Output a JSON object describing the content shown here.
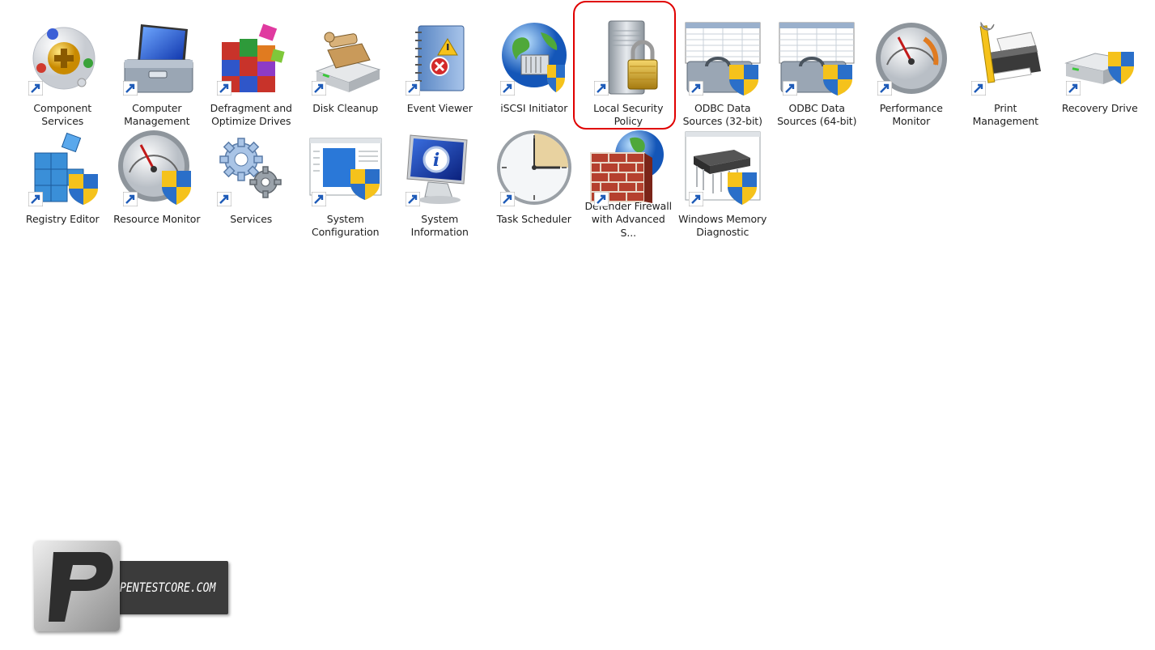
{
  "tools": [
    {
      "id": "component-services",
      "label": "Component Services",
      "icon": "component-services-icon"
    },
    {
      "id": "computer-management",
      "label": "Computer Management",
      "icon": "computer-management-icon"
    },
    {
      "id": "defragment",
      "label": "Defragment and Optimize Drives",
      "icon": "defragment-icon"
    },
    {
      "id": "disk-cleanup",
      "label": "Disk Cleanup",
      "icon": "disk-cleanup-icon"
    },
    {
      "id": "event-viewer",
      "label": "Event Viewer",
      "icon": "event-viewer-icon"
    },
    {
      "id": "iscsi-initiator",
      "label": "iSCSI Initiator",
      "icon": "iscsi-globe-icon"
    },
    {
      "id": "local-security-policy",
      "label": "Local Security Policy",
      "icon": "security-policy-lock-icon",
      "highlighted": true
    },
    {
      "id": "odbc-32",
      "label": "ODBC Data Sources (32-bit)",
      "icon": "odbc-toolbox-icon"
    },
    {
      "id": "odbc-64",
      "label": "ODBC Data Sources (64-bit)",
      "icon": "odbc-toolbox-icon"
    },
    {
      "id": "performance-monitor",
      "label": "Performance Monitor",
      "icon": "gauge-icon"
    },
    {
      "id": "print-management",
      "label": "Print Management",
      "icon": "printer-icon"
    },
    {
      "id": "recovery-drive",
      "label": "Recovery Drive",
      "icon": "recovery-drive-icon"
    },
    {
      "id": "registry-editor",
      "label": "Registry Editor",
      "icon": "registry-cubes-icon"
    },
    {
      "id": "resource-monitor",
      "label": "Resource Monitor",
      "icon": "gauge-shield-icon"
    },
    {
      "id": "services",
      "label": "Services",
      "icon": "gears-icon"
    },
    {
      "id": "system-configuration",
      "label": "System Configuration",
      "icon": "system-config-window-icon"
    },
    {
      "id": "system-information",
      "label": "System Information",
      "icon": "system-info-monitor-icon"
    },
    {
      "id": "task-scheduler",
      "label": "Task Scheduler",
      "icon": "clock-icon"
    },
    {
      "id": "windows-defender-firewall",
      "label": "Windows Defender Firewall with Advanced S...",
      "icon": "firewall-brick-globe-icon"
    },
    {
      "id": "windows-memory-diagnostic",
      "label": "Windows Memory Diagnostic",
      "icon": "memory-chip-icon"
    }
  ],
  "watermark": {
    "text": "PENTESTCORE.COM",
    "letter": "P"
  },
  "colors": {
    "highlight": "#e00000",
    "shield_blue": "#2a6fc9",
    "shield_yellow": "#f5c21b"
  }
}
